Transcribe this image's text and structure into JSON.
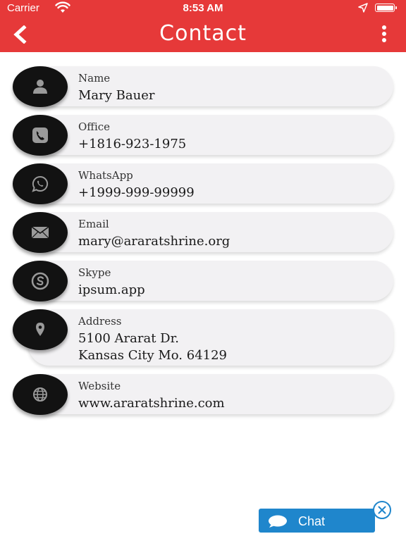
{
  "status_bar": {
    "carrier": "Carrier",
    "time": "8:53 AM"
  },
  "nav": {
    "title": "Contact",
    "back_icon": "chevron-left-icon",
    "more_icon": "more-vertical-icon"
  },
  "contacts": [
    {
      "label": "Name",
      "value": "Mary Bauer",
      "icon": "person-icon"
    },
    {
      "label": "Office",
      "value": "+1816-923-1975",
      "icon": "phone-icon"
    },
    {
      "label": "WhatsApp",
      "value": "+1999-999-99999",
      "icon": "whatsapp-icon"
    },
    {
      "label": "Email",
      "value": "mary@araratshrine.org",
      "icon": "email-icon"
    },
    {
      "label": "Skype",
      "value": "ipsum.app",
      "icon": "skype-icon"
    },
    {
      "label": "Address",
      "value_line1": "5100 Ararat Dr.",
      "value_line2": "Kansas City Mo. 64129",
      "icon": "location-pin-icon"
    },
    {
      "label": "Website",
      "value": "www.araratshrine.com",
      "icon": "globe-icon"
    }
  ],
  "chat": {
    "label": "Chat",
    "icon": "chat-bubble-icon"
  },
  "colors": {
    "header": "#e63939",
    "chat": "#1f86cc",
    "card": "#f2f1f3",
    "icon_circle": "#121212"
  }
}
